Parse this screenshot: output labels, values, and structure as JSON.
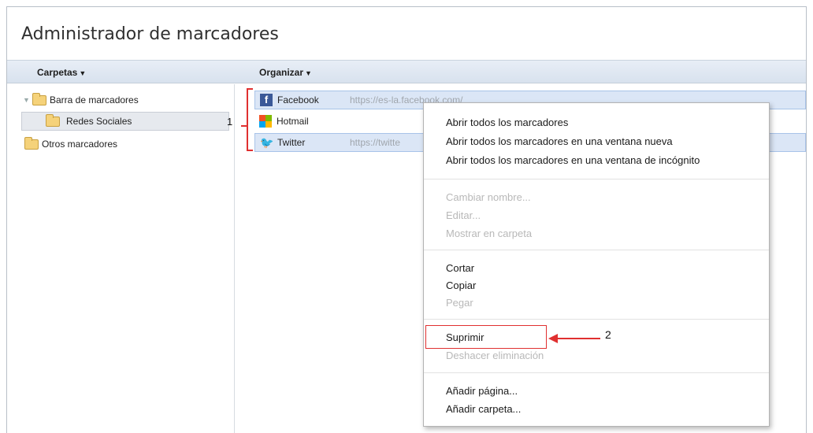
{
  "window": {
    "title": "Administrador de marcadores"
  },
  "toolbar": {
    "folders_label": "Carpetas",
    "organize_label": "Organizar"
  },
  "sidebar": {
    "items": [
      {
        "label": "Barra de marcadores"
      },
      {
        "label": "Redes Sociales"
      },
      {
        "label": "Otros marcadores"
      }
    ]
  },
  "bookmarks": [
    {
      "name": "Facebook",
      "url": "https://es-la.facebook.com/"
    },
    {
      "name": "Hotmail",
      "url": ""
    },
    {
      "name": "Twitter",
      "url": "https://twitte"
    }
  ],
  "context_menu": {
    "open_all": "Abrir todos los marcadores",
    "open_all_new_window": "Abrir todos los marcadores en una ventana nueva",
    "open_all_incognito": "Abrir todos los marcadores en una ventana de incógnito",
    "rename": "Cambiar nombre...",
    "edit": "Editar...",
    "show_in_folder": "Mostrar en carpeta",
    "cut": "Cortar",
    "copy": "Copiar",
    "paste": "Pegar",
    "delete": "Suprimir",
    "undo_delete": "Deshacer eliminación",
    "add_page": "Añadir página...",
    "add_folder": "Añadir carpeta..."
  },
  "annotations": {
    "marker_1": "1",
    "marker_2": "2"
  },
  "colors": {
    "annotation_red": "#e03030",
    "toolbar_bg": "#dde6f0",
    "selection_bg": "#dbe6f6"
  }
}
